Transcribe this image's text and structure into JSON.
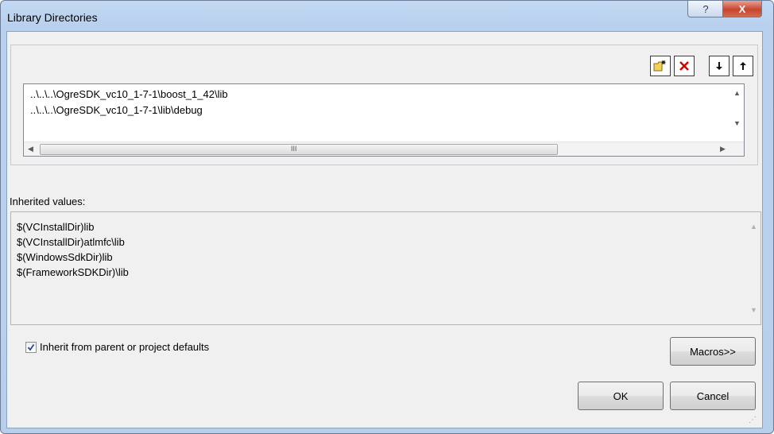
{
  "window": {
    "title": "Library Directories",
    "help_glyph": "?",
    "close_glyph": "X"
  },
  "toolbar": {
    "new_line_icon": "new-folder-icon",
    "delete_icon": "delete-icon",
    "move_down_icon": "move-down-icon",
    "move_up_icon": "move-up-icon"
  },
  "directories": {
    "items": [
      "..\\..\\..\\OgreSDK_vc10_1-7-1\\boost_1_42\\lib",
      "..\\..\\..\\OgreSDK_vc10_1-7-1\\lib\\debug"
    ],
    "scroll_grip": "III"
  },
  "inherited": {
    "label": "Inherited values:",
    "items": [
      "$(VCInstallDir)lib",
      "$(VCInstallDir)atlmfc\\lib",
      "$(WindowsSdkDir)lib",
      "$(FrameworkSDKDir)\\lib"
    ]
  },
  "options": {
    "inherit_label": "Inherit from parent or project defaults",
    "inherit_checked": true
  },
  "buttons": {
    "macros": "Macros>>",
    "ok": "OK",
    "cancel": "Cancel"
  },
  "colors": {
    "close_red": "#c8452f",
    "title_bar": "#b9d1ee",
    "dialog_bg": "#f0f0f0",
    "delete_red": "#d40000",
    "folder_yellow": "#f3d25a"
  }
}
